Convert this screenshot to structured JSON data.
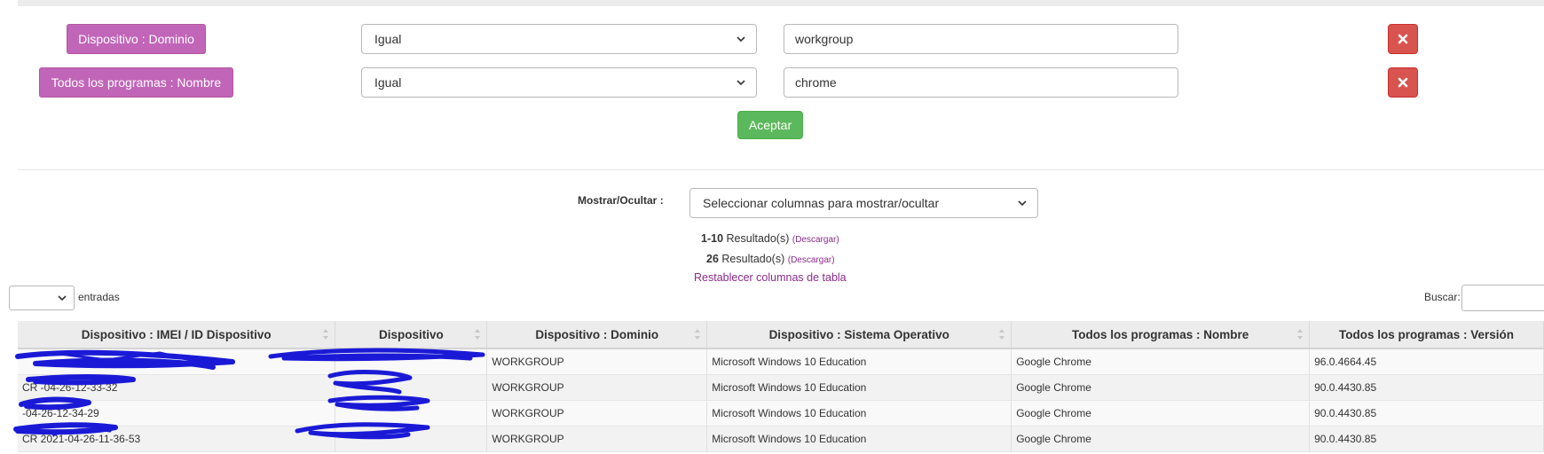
{
  "filters": [
    {
      "field": "Dispositivo : Dominio",
      "operator": "Igual",
      "value": "workgroup"
    },
    {
      "field": "Todos los programas : Nombre",
      "operator": "Igual",
      "value": "chrome"
    }
  ],
  "icons": {
    "remove": "close-icon",
    "dropdown": "chevron-down-icon",
    "sort": "sort-icon"
  },
  "accept_label": "Aceptar",
  "toggle": {
    "label": "Mostrar/Ocultar :",
    "select_value": "Seleccionar columnas para mostrar/ocultar"
  },
  "results": [
    {
      "count": "1-10",
      "text": "Resultado(s)",
      "download": "(Descargar)"
    },
    {
      "count": "26",
      "text": "Resultado(s)",
      "download": "(Descargar)"
    }
  ],
  "reset_columns": "Restablecer columnas de tabla",
  "length_label": "entradas",
  "search_label": "Buscar:",
  "colors": {
    "tag": "#c165b8",
    "remove": "#d9534f",
    "accept": "#5cb85c",
    "link": "#8b2a8b",
    "redaction": "#1a1ad6"
  },
  "table": {
    "columns": [
      "Dispositivo : IMEI / ID Dispositivo",
      "Dispositivo",
      "Dispositivo : Dominio",
      "Dispositivo : Sistema Operativo",
      "Todos los programas : Nombre",
      "Todos los programas : Versión"
    ],
    "rows": [
      [
        "",
        "",
        "WORKGROUP",
        "Microsoft Windows 10 Education",
        "Google Chrome",
        "96.0.4664.45"
      ],
      [
        "CR -04-26-12-33-32",
        "",
        "WORKGROUP",
        "Microsoft Windows 10 Education",
        "Google Chrome",
        "90.0.4430.85"
      ],
      [
        "-04-26-12-34-29",
        "",
        "WORKGROUP",
        "Microsoft Windows 10 Education",
        "Google Chrome",
        "90.0.4430.85"
      ],
      [
        "CR 2021-04-26-11-36-53",
        "",
        "WORKGROUP",
        "Microsoft Windows 10 Education",
        "Google Chrome",
        "90.0.4430.85"
      ]
    ]
  }
}
